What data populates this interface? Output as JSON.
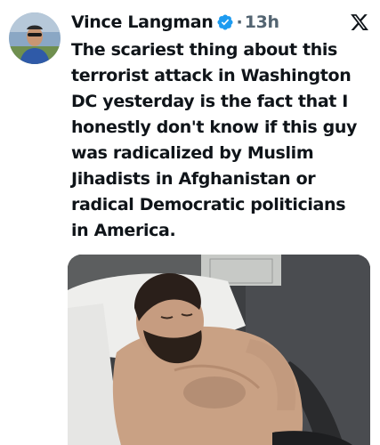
{
  "author": {
    "display_name": "Vince Langman",
    "verified": true,
    "avatar_icon": "profile-photo-avatar",
    "verified_color": "#1d9bf0"
  },
  "meta": {
    "separator": "·",
    "time": "13h"
  },
  "tweet": {
    "lines": [
      "The scariest thing about this",
      "terrorist attack in Washington",
      "DC yesterday is the fact that I",
      "honestly don't know if this guy",
      "was radicalized by Muslim",
      "Jihadists in Afghanistan or",
      "radical Democratic politicians",
      "in America."
    ]
  },
  "brand": {
    "logo_icon": "x-logo-icon"
  },
  "media": {
    "type": "photo",
    "icon": "photo-man-lying-down"
  },
  "colors": {
    "text": "#0f1419",
    "secondary": "#536471",
    "background": "#ffffff"
  }
}
